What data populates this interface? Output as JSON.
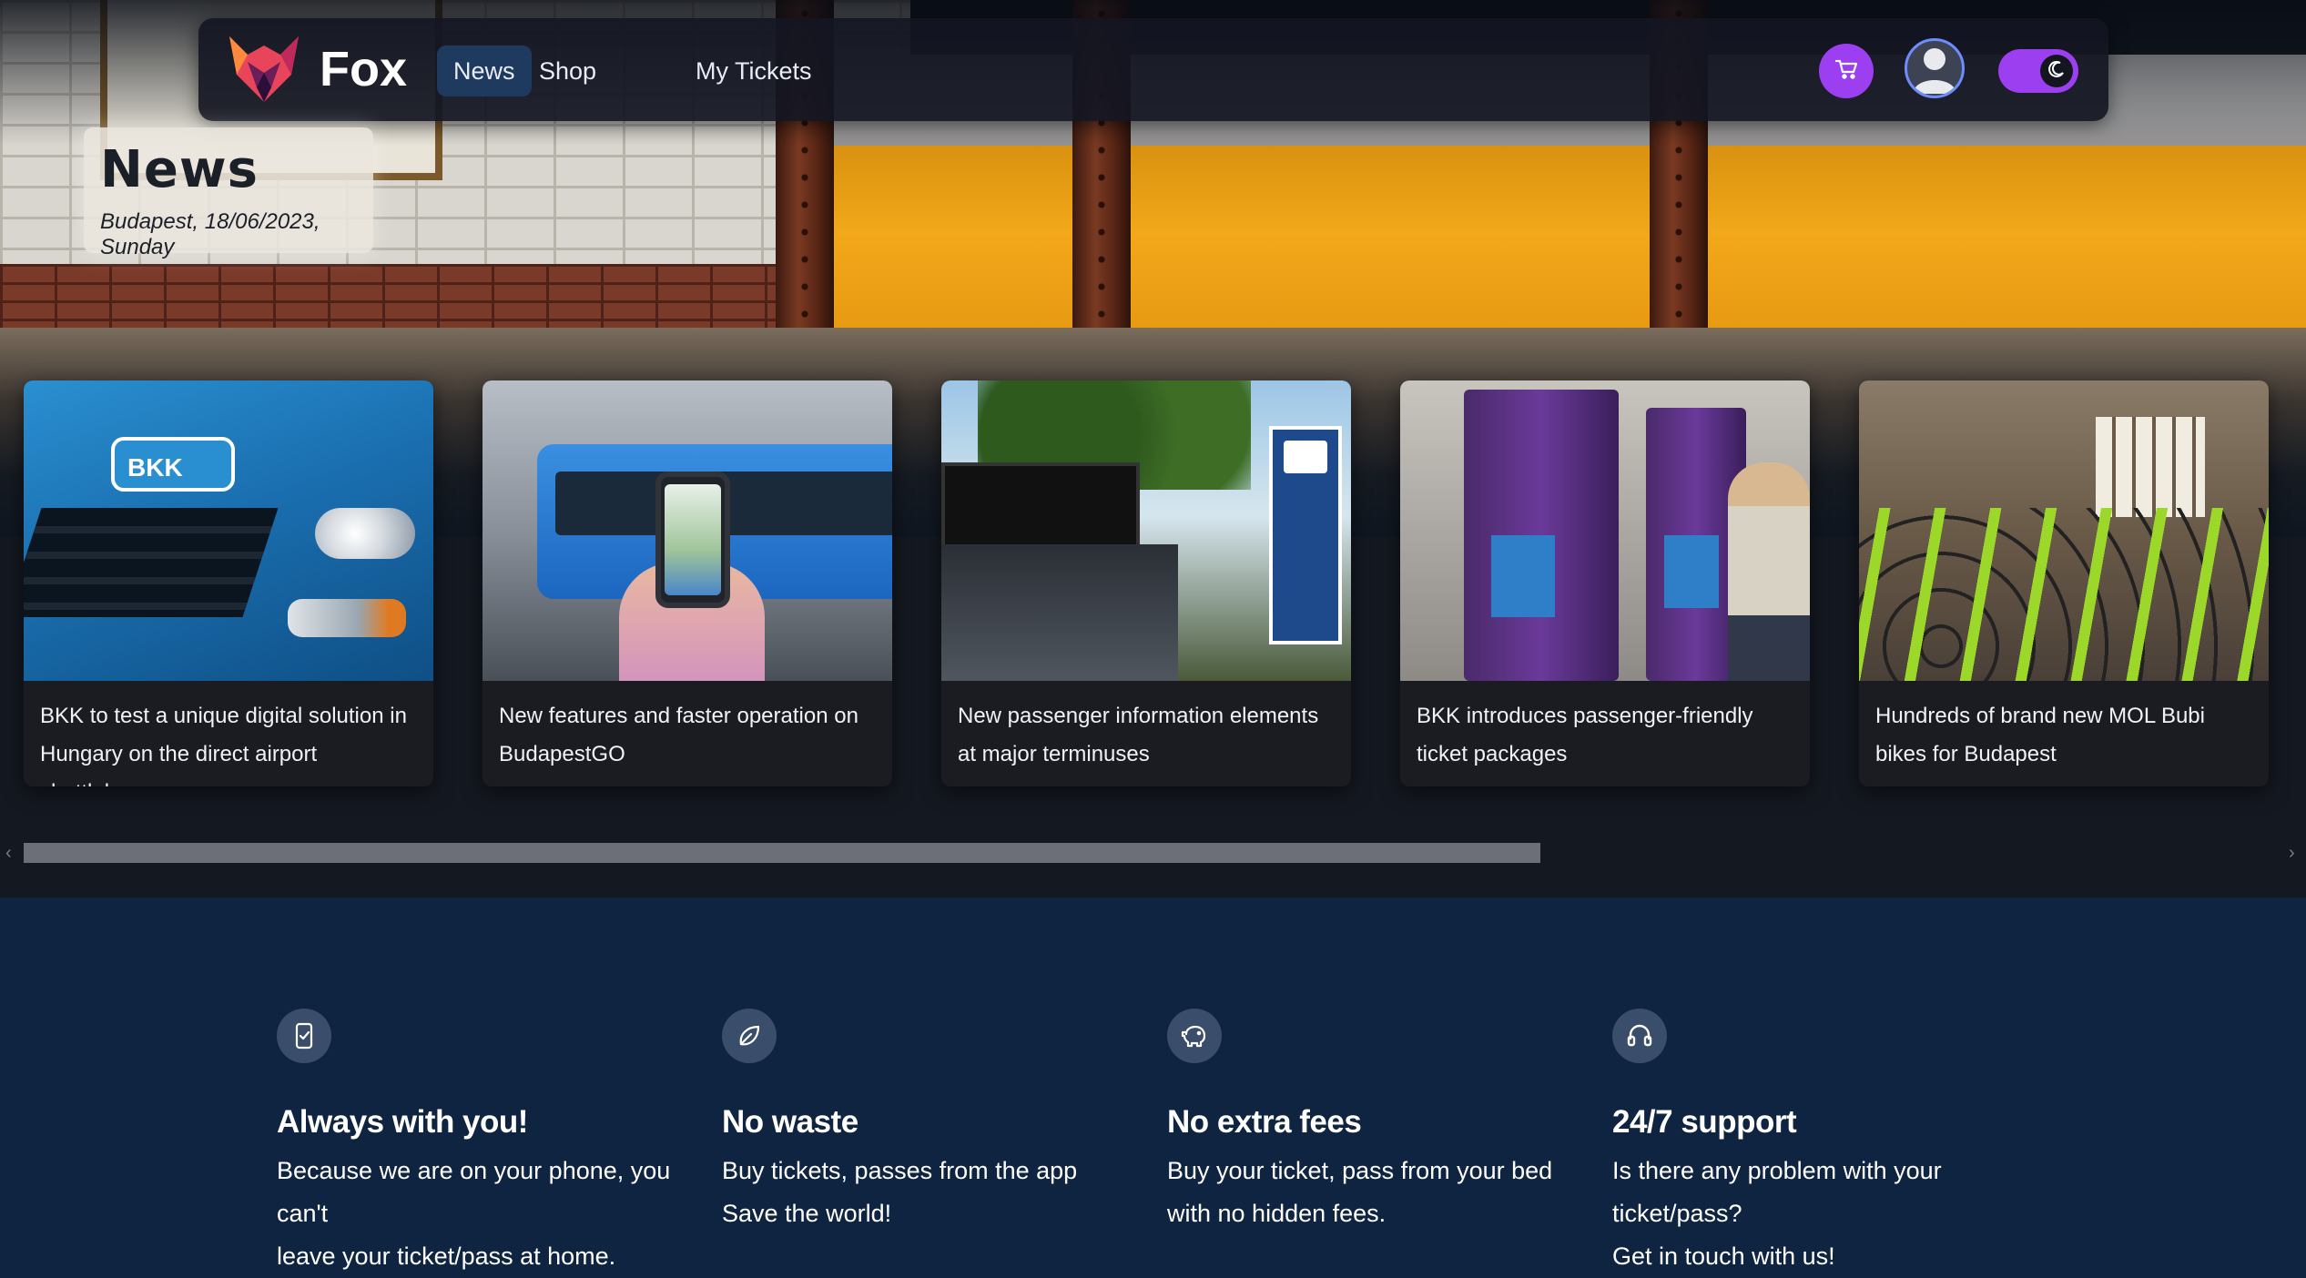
{
  "navbar": {
    "brand": "Fox",
    "links": [
      {
        "label": "News",
        "active": true
      },
      {
        "label": "Shop",
        "active": false
      },
      {
        "label": "My Tickets",
        "active": false
      }
    ],
    "icons": {
      "cart": "cart-icon",
      "user": "user-avatar-icon",
      "theme": "moon-icon"
    },
    "accent": "#9b3ff0"
  },
  "heading": {
    "title": "News",
    "subtitle": "Budapest, 18/06/2023, Sunday"
  },
  "news": [
    {
      "title": "BKK to test a unique digital solution in Hungary on the direct airport shuttlebus...",
      "image_text": "BKK"
    },
    {
      "title": "New features and faster operation on BudapestGO"
    },
    {
      "title": "New passenger information elements at major terminuses"
    },
    {
      "title": "BKK introduces passenger-friendly ticket packages"
    },
    {
      "title": "Hundreds of brand new MOL Bubi bikes for Budapest"
    }
  ],
  "scrollbar": {
    "left_arrow": "‹",
    "right_arrow": "›"
  },
  "features": [
    {
      "icon": "phone-check-icon",
      "title": "Always with you!",
      "desc": "Because we are on your phone, you can't\nleave your ticket/pass at home."
    },
    {
      "icon": "leaf-icon",
      "title": "No waste",
      "desc": "Buy tickets, passes from the app\nSave the world!"
    },
    {
      "icon": "piggy-bank-icon",
      "title": "No extra fees",
      "desc": "Buy your ticket, pass from your bed\nwith no hidden fees."
    },
    {
      "icon": "headset-icon",
      "title": "24/7 support",
      "desc": "Is there any problem with your ticket/pass?\nGet in touch with us!"
    }
  ]
}
